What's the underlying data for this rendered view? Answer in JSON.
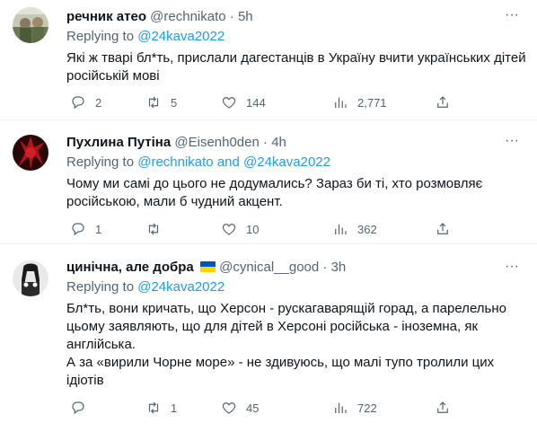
{
  "tweets": [
    {
      "author_name": "речник атео",
      "handle": "@rechnikato",
      "dot": "·",
      "time": "5h",
      "replying_prefix": "Replying to",
      "replying_to": "@24kava2022",
      "text_lines": [
        "Які ж тварі бл*ть, прислали дагестанців в Україну вчити українських дітей",
        "російській мові"
      ],
      "replies": "2",
      "retweets": "5",
      "likes": "144",
      "views": "2,771",
      "more": "···"
    },
    {
      "author_name": "Пухлина Путіна",
      "handle": "@Eisenh0den",
      "dot": "·",
      "time": "4h",
      "replying_prefix": "Replying to",
      "replying_to": "@rechnikato and @24kava2022",
      "text_lines": [
        "Чому ми самі до цього не додумались? Зараз би ті, хто розмовляє",
        "російською, мали б чудний акцент."
      ],
      "replies": "1",
      "retweets": "",
      "likes": "10",
      "views": "362",
      "more": "···"
    },
    {
      "author_name": "цинічна, але добра",
      "handle": "@cynical__good",
      "dot": "·",
      "time": "3h",
      "replying_prefix": "Replying to",
      "replying_to": "@24kava2022",
      "text_lines": [
        "Бл*ть, вони кричать, що Херсон - рускагаварящій горад, а парелельно",
        "цьому заявляють, що для дітей в Херсоні російська - іноземна, як",
        "англійська.",
        "А за «вирили Чорне море» - не здивуюсь, що малі тупо тролили цих",
        "ідіотів"
      ],
      "replies": "",
      "retweets": "1",
      "likes": "45",
      "views": "722",
      "more": "···"
    }
  ],
  "colors": {
    "text": "#0f1419",
    "secondary": "#536471",
    "link": "#1d9bf0",
    "divider": "#eff3f4",
    "flag_blue": "#0057b7",
    "flag_yellow": "#ffd700"
  }
}
